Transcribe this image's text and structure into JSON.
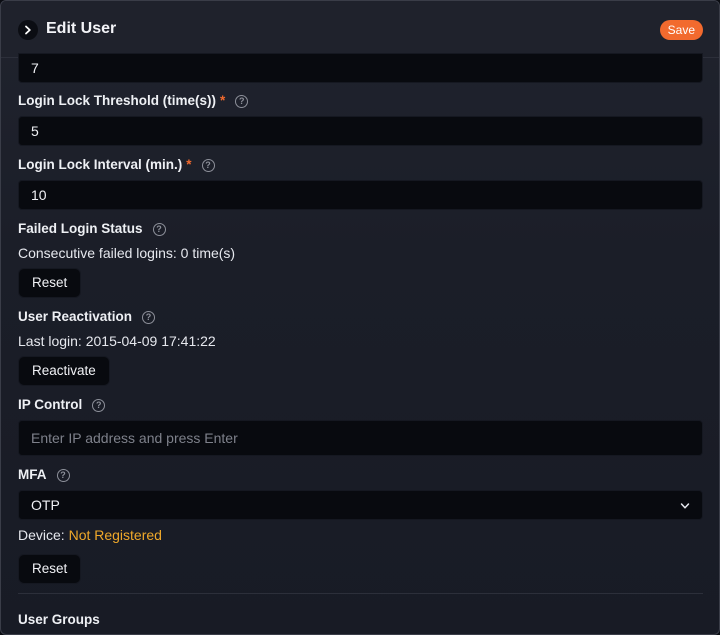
{
  "header": {
    "title": "Edit User",
    "save_label": "Save"
  },
  "fields": {
    "top_value": "7",
    "lock_threshold": {
      "label": "Login Lock Threshold (time(s))",
      "required": "*",
      "value": "5"
    },
    "lock_interval": {
      "label": "Login Lock Interval (min.)",
      "required": "*",
      "value": "10"
    },
    "failed_login": {
      "label": "Failed Login Status",
      "text": "Consecutive failed logins: 0 time(s)",
      "button": "Reset"
    },
    "reactivation": {
      "label": "User Reactivation",
      "text": "Last login: 2015-04-09 17:41:22",
      "button": "Reactivate"
    },
    "ip_control": {
      "label": "IP Control",
      "placeholder": "Enter IP address and press Enter"
    },
    "mfa": {
      "label": "MFA",
      "value": "OTP",
      "device_label": "Device: ",
      "device_status": "Not Registered",
      "button": "Reset"
    },
    "user_groups": {
      "label": "User Groups"
    }
  },
  "help_glyph": "?",
  "colors": {
    "accent": "#f26a2e",
    "warning": "#f0a92a"
  }
}
